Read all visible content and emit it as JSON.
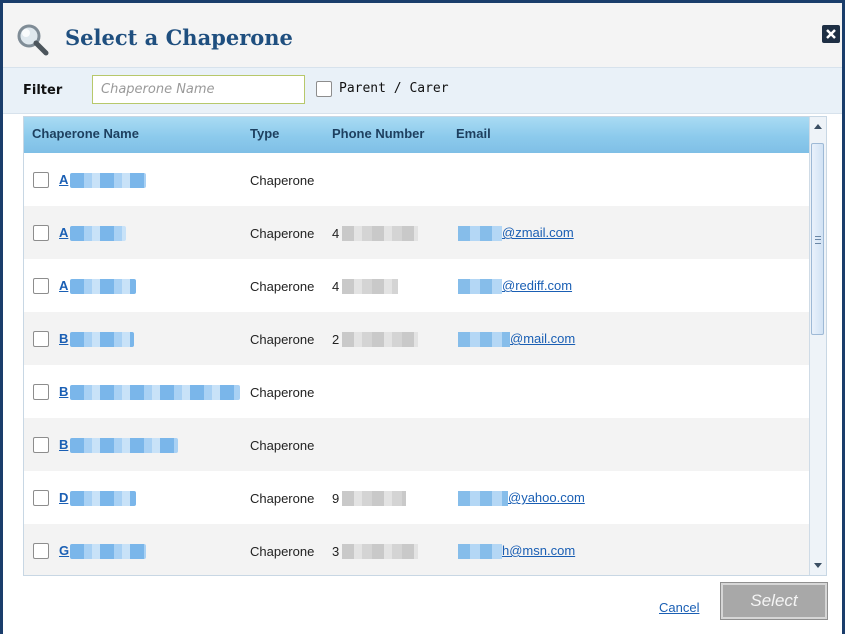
{
  "dialog": {
    "title": "Select a Chaperone",
    "icons": {
      "header": "magnifier-icon",
      "close": "close-x-icon"
    }
  },
  "filter": {
    "label": "Filter",
    "placeholder": "Chaperone Name",
    "value": "",
    "parent_carer_label": "Parent / Carer",
    "parent_carer_checked": false
  },
  "grid": {
    "columns": [
      "Chaperone Name",
      "Type",
      "Phone Number",
      "Email"
    ],
    "rows": [
      {
        "name_initial": "A",
        "type": "Chaperone",
        "phone_prefix": "",
        "email_domain": ""
      },
      {
        "name_initial": "A",
        "type": "Chaperone",
        "phone_prefix": "4",
        "email_domain": "@zmail.com"
      },
      {
        "name_initial": "A",
        "type": "Chaperone",
        "phone_prefix": "4",
        "email_domain": "@rediff.com"
      },
      {
        "name_initial": "B",
        "type": "Chaperone",
        "phone_prefix": "2",
        "email_domain": "@mail.com"
      },
      {
        "name_initial": "B",
        "type": "Chaperone",
        "phone_prefix": "",
        "email_domain": ""
      },
      {
        "name_initial": "B",
        "type": "Chaperone",
        "phone_prefix": "",
        "email_domain": ""
      },
      {
        "name_initial": "D",
        "type": "Chaperone",
        "phone_prefix": "9",
        "email_domain": "@yahoo.com"
      },
      {
        "name_initial": "G",
        "type": "Chaperone",
        "phone_prefix": "3",
        "email_domain": "h@msn.com"
      }
    ]
  },
  "footer": {
    "cancel_label": "Cancel",
    "select_label": "Select"
  },
  "colors": {
    "title": "#1f4f7f",
    "link": "#1a5fb4",
    "header_gradient_top": "#a9dbf3",
    "select_disabled": "#a8a8a8"
  }
}
